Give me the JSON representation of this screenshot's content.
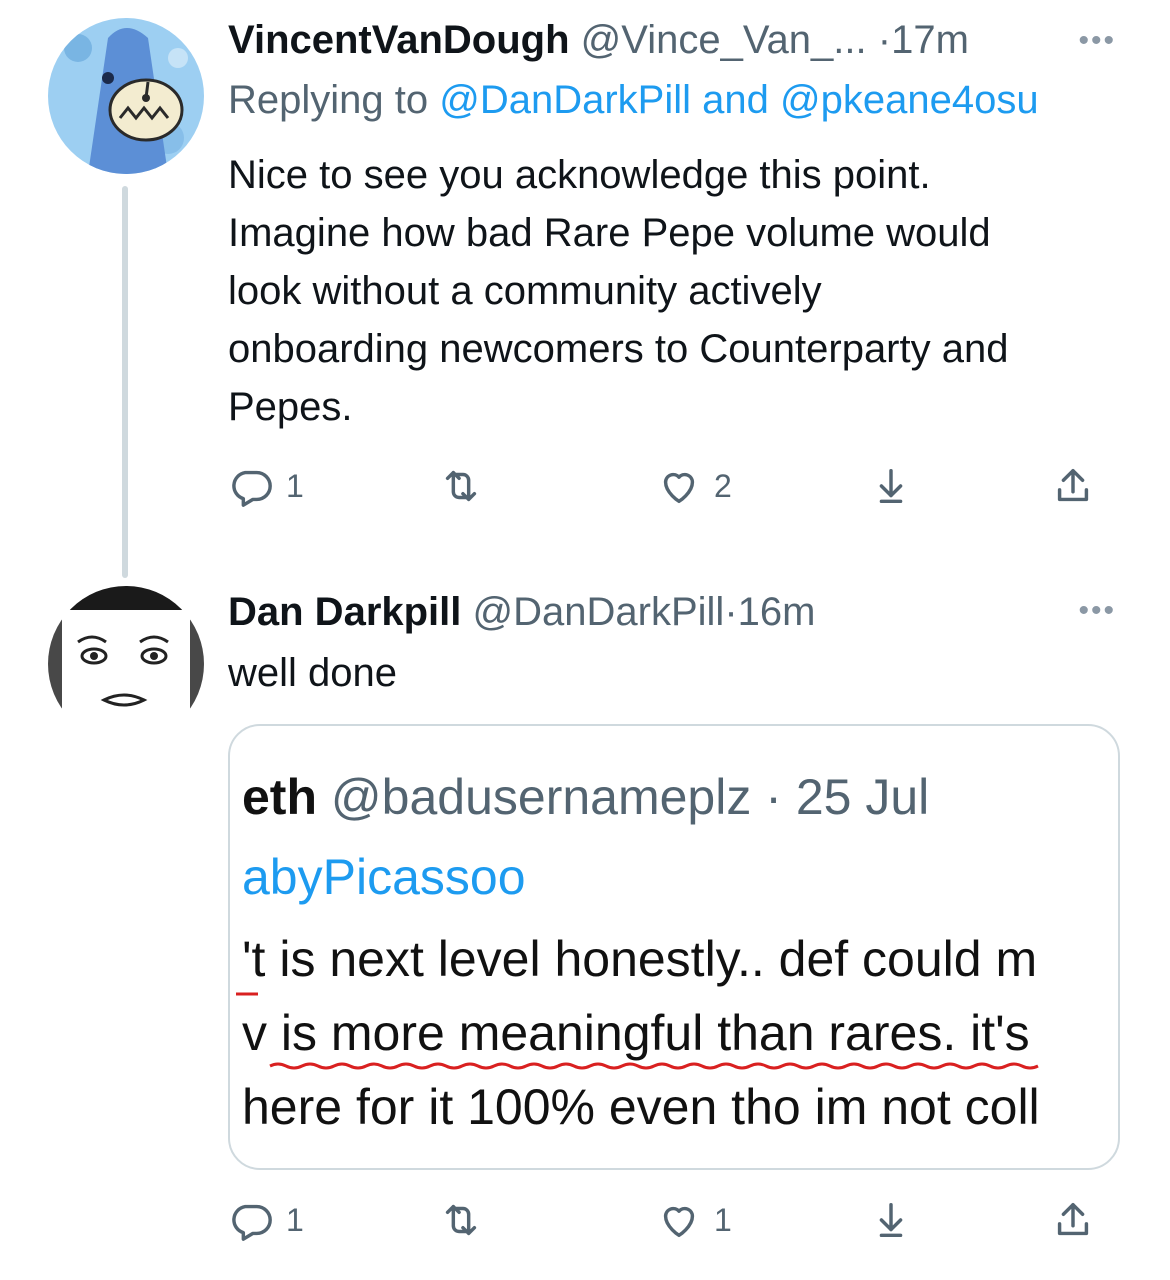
{
  "tweets": [
    {
      "name": "VincentVanDough",
      "handle": "@Vince_Van_...",
      "dot": "·",
      "time": "17m",
      "more": "•••",
      "replying_prefix": "Replying to ",
      "replying_user1": "@DanDarkPill",
      "replying_and": " and ",
      "replying_user2": "@pkeane4osu",
      "text_lines": [
        "Nice to see you acknowledge this point.",
        "Imagine how bad Rare Pepe volume would",
        "look without a community actively",
        "onboarding newcomers to Counterparty and",
        "Pepes."
      ],
      "reply_count": "1",
      "retweet_count": "",
      "like_count": "2"
    },
    {
      "name": "Dan Darkpill",
      "handle": "@DanDarkPill",
      "dot": "·",
      "time": "16m",
      "more": "•••",
      "text": "well done",
      "reply_count": "1",
      "retweet_count": "",
      "like_count": "1"
    }
  ],
  "quoted_screenshot": {
    "name": "eth",
    "handle": "@badusernameplz",
    "dot": "·",
    "date": "25 Jul",
    "replying": "abyPicassoo",
    "lines": [
      "'t is next level honestly.. def could m",
      "v is more meaningful than rares. it's",
      " here for it 100% even tho im not coll"
    ]
  },
  "colors": {
    "text": "#0f1419",
    "secondary": "#536471",
    "link": "#1d9bf0",
    "thread_line": "#cfd9de",
    "spellcheck_underline": "#d92020"
  },
  "icons": [
    "reply-icon",
    "retweet-icon",
    "like-icon",
    "download-icon",
    "share-icon",
    "more-icon"
  ]
}
